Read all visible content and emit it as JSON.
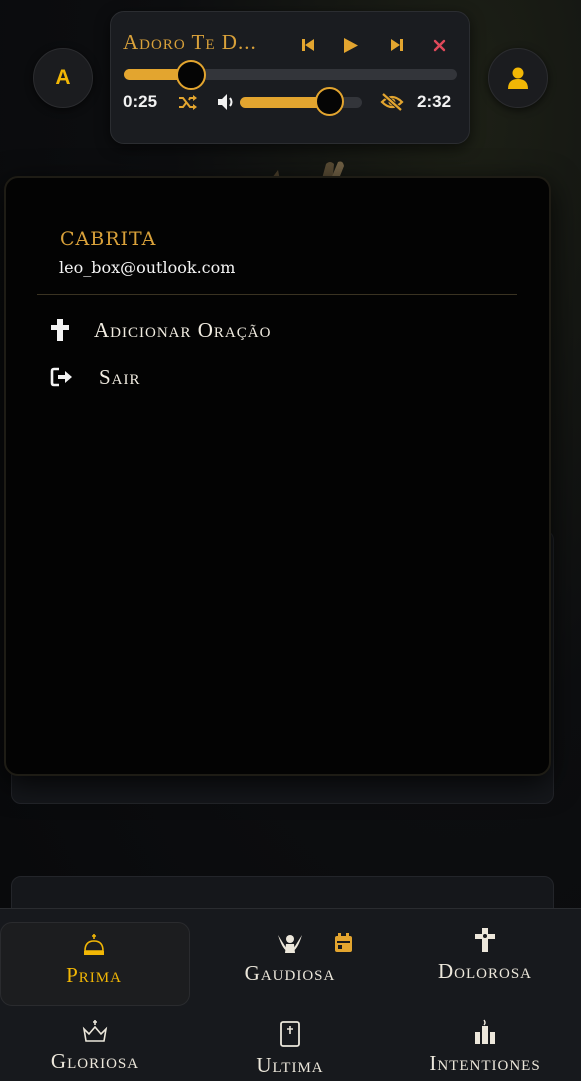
{
  "header": {
    "avatar_letter": "A"
  },
  "player": {
    "title": "Adoro Te D...",
    "elapsed": "0:25",
    "duration": "2:32",
    "progress_fraction": 0.2,
    "volume_fraction": 0.73,
    "accent_color": "#e3a52f",
    "close_color": "#e0495a"
  },
  "menu": {
    "user_name": "CABRITA",
    "user_email": "leo_box@outlook.com",
    "items": [
      {
        "label": "Adicionar Oração",
        "icon": "cross-icon"
      },
      {
        "label": "Sair",
        "icon": "sign-out-icon"
      }
    ]
  },
  "nav": {
    "items": [
      {
        "label": "Prima",
        "icon": "crown-icon",
        "active": true
      },
      {
        "label": "Gaudiosa",
        "icon": "angel-icon"
      },
      {
        "label": "Dolorosa",
        "icon": "crucifix-icon"
      },
      {
        "label": "Gloriosa",
        "icon": "crown-cross-icon"
      },
      {
        "label": "Ultima",
        "icon": "bible-icon"
      },
      {
        "label": "Intentiones",
        "icon": "candles-icon"
      }
    ],
    "active_color": "#f2b705"
  }
}
